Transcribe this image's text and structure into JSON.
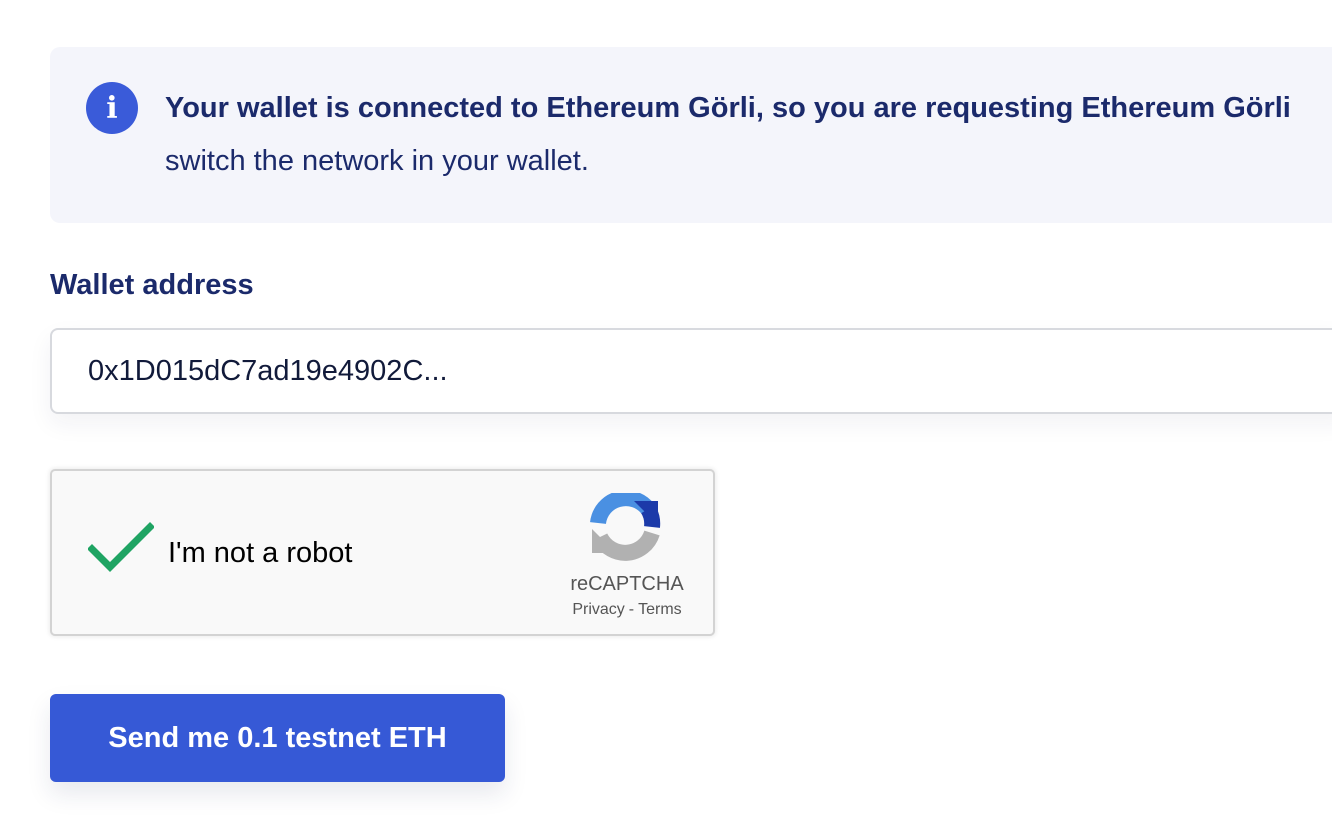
{
  "info": {
    "icon": "info-icon",
    "icon_glyph": "i",
    "line1": "Your wallet is connected to Ethereum Görli, so you are requesting Ethereum Görli",
    "line2": "switch the network in your wallet."
  },
  "wallet": {
    "label": "Wallet address",
    "value": "0x1D015dC7ad19e4902C..."
  },
  "recaptcha": {
    "checked": true,
    "label": "I'm not a robot",
    "brand": "reCAPTCHA",
    "privacy_link": "Privacy",
    "separator": "-",
    "terms_link": "Terms"
  },
  "send_button": {
    "label": "Send me 0.1 testnet ETH"
  },
  "colors": {
    "accent": "#3659d6",
    "text_dark": "#1b2a6b",
    "banner_bg": "#f4f5fb",
    "check_green": "#1fa463"
  }
}
